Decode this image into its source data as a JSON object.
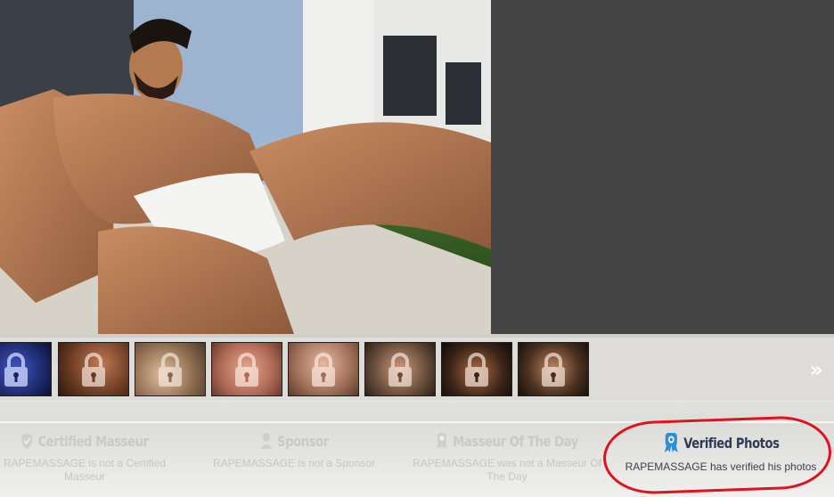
{
  "gallery": {
    "next_label": "»",
    "thumbnails": [
      {
        "locked": false,
        "tint": "#2a3a8a"
      },
      {
        "locked": true,
        "tint": "#6a3a22"
      },
      {
        "locked": true,
        "tint": "#8b6a4e"
      },
      {
        "locked": true,
        "tint": "#b06a55"
      },
      {
        "locked": true,
        "tint": "#a07058"
      },
      {
        "locked": true,
        "tint": "#6a4e3c"
      },
      {
        "locked": true,
        "tint": "#3a2418"
      },
      {
        "locked": true,
        "tint": "#4a3020"
      }
    ]
  },
  "badges": {
    "certified": {
      "title": "Certified Masseur",
      "desc": "RAPEMASSAGE is not a Certified Masseur",
      "icon": "certified-check-icon",
      "active": false
    },
    "sponsor": {
      "title": "Sponsor",
      "desc": "RAPEMASSAGE is not a Sponsor",
      "icon": "sponsor-person-icon",
      "active": false
    },
    "motd": {
      "title": "Masseur Of The Day",
      "desc": "RAPEMASSAGE was not a Masseur Of The Day",
      "icon": "award-ribbon-icon",
      "active": false
    },
    "verified": {
      "title": "Verified Photos",
      "desc": "RAPEMASSAGE has verified his photos",
      "icon": "verified-ribbon-icon",
      "active": true
    }
  },
  "colors": {
    "accent": "#2f8fd6",
    "highlight_ring": "#e0121e",
    "photo_bg": "#444444"
  }
}
